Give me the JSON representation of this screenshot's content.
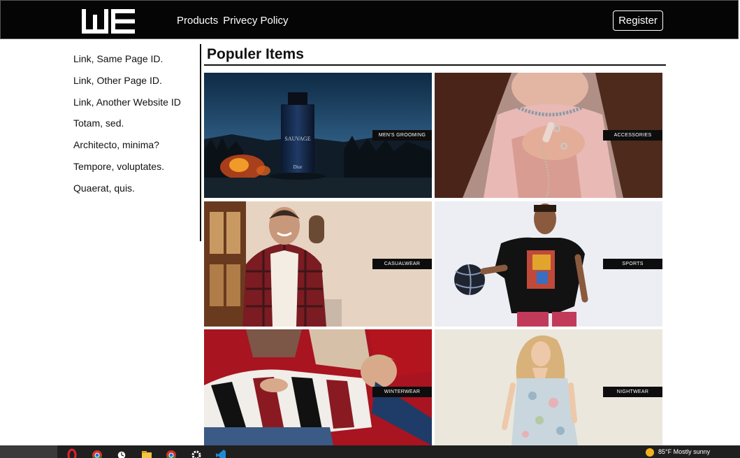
{
  "brand": {
    "logo_text": "WE"
  },
  "nav": {
    "links": [
      {
        "label": "Products"
      },
      {
        "label": "Privecy Policy"
      }
    ],
    "register_label": "Register"
  },
  "sidebar": {
    "links": [
      {
        "label": "Link, Same Page ID."
      },
      {
        "label": "Link, Other Page ID."
      },
      {
        "label": "Link, Another Website ID"
      },
      {
        "label": "Totam, sed."
      },
      {
        "label": "Architecto, minima?"
      },
      {
        "label": "Tempore, voluptates."
      },
      {
        "label": "Quaerat, quis."
      }
    ]
  },
  "main": {
    "title": "Populer Items",
    "tiles": [
      {
        "label": "MEN'S GROOMING",
        "product_text": "SAUVAGE",
        "brand_text": "Dior"
      },
      {
        "label": "ACCESSORIES"
      },
      {
        "label": "CASUALWEAR"
      },
      {
        "label": "SPORTS"
      },
      {
        "label": "WINTERWEAR"
      },
      {
        "label": "NIGHTWEAR"
      }
    ]
  },
  "taskbar": {
    "icons": [
      "opera-icon",
      "chrome-icon",
      "clock-icon",
      "folder-icon",
      "chrome-icon",
      "settings-icon",
      "vscode-icon"
    ],
    "weather": "85°F  Mostly sunny"
  },
  "colors": {
    "navbar_bg": "#050505",
    "label_bg": "#0d0d0d",
    "accent_orange": "#f2b01e"
  }
}
